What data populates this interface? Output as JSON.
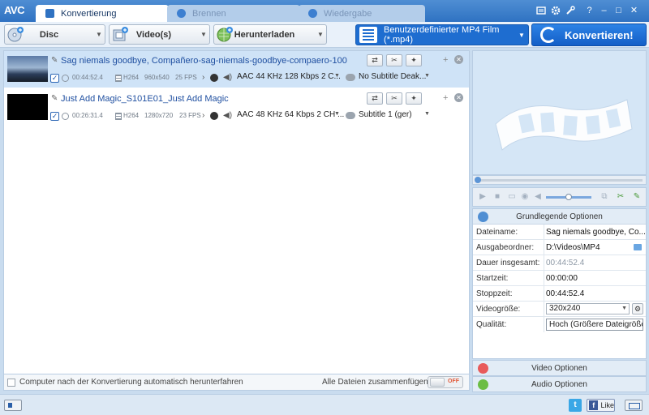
{
  "app": {
    "logo": "AVC"
  },
  "tabs": [
    {
      "label": "Konvertierung",
      "active": true
    },
    {
      "label": "Brennen",
      "active": false
    },
    {
      "label": "Wiedergabe",
      "active": false
    }
  ],
  "window_icons": [
    "skin-icon",
    "settings-icon",
    "tools-icon",
    "help-icon",
    "minimize-icon",
    "maximize-icon",
    "close-icon"
  ],
  "window_glyphs": {
    "help": "?",
    "minimize": "–",
    "maximize": "□",
    "close": "✕"
  },
  "toolbar": {
    "disc": "Disc",
    "videos": "Video(s)",
    "download": "Herunterladen",
    "profile": "Benutzerdefinierter MP4 Film (*.mp4)",
    "convert": "Konvertieren!"
  },
  "files": [
    {
      "title": "Sag niemals goodbye, Compañero-sag-niemals-goodbye-compaero-100",
      "duration": "00:44:52.4",
      "codec": "H264",
      "resolution": "960x540",
      "fps": "25 FPS",
      "audio": "AAC 44 KHz 128 Kbps 2 C...",
      "subtitle": "No Subtitle Deak...",
      "checked": true,
      "selected": true
    },
    {
      "title": "Just Add Magic_S101E01_Just Add Magic",
      "duration": "00:26:31.4",
      "codec": "H264",
      "resolution": "1280x720",
      "fps": "23 FPS",
      "audio": "AAC 48 KHz 64 Kbps 2 CH ...",
      "subtitle": "Subtitle 1 (ger)",
      "checked": true,
      "selected": false
    }
  ],
  "bottom": {
    "shutdown": "Computer nach der Konvertierung automatisch herunterfahren",
    "merge": "Alle Dateien zusammenfügen",
    "toggle": "OFF"
  },
  "options": {
    "header": "Grundlegende Optionen",
    "filename_label": "Dateiname:",
    "filename": "Sag niemals goodbye, Co...",
    "output_label": "Ausgabeordner:",
    "output": "D:\\Videos\\MP4",
    "duration_label": "Dauer insgesamt:",
    "duration": "00:44:52.4",
    "start_label": "Startzeit:",
    "start": "00:00:00",
    "stop_label": "Stoppzeit:",
    "stop": "00:44:52.4",
    "size_label": "Videogröße:",
    "size": "320x240",
    "quality_label": "Qualität:",
    "quality": "Hoch (Größere Dateigröße)"
  },
  "sections": {
    "video": "Video Optionen",
    "audio": "Audio Optionen"
  },
  "social": {
    "twitter": "t",
    "facebook": "f",
    "like": "Like"
  },
  "colors": {
    "accent": "#1e6dd0",
    "selected_row": "#cfe3f7",
    "toggle_off": "#e25b3a"
  }
}
